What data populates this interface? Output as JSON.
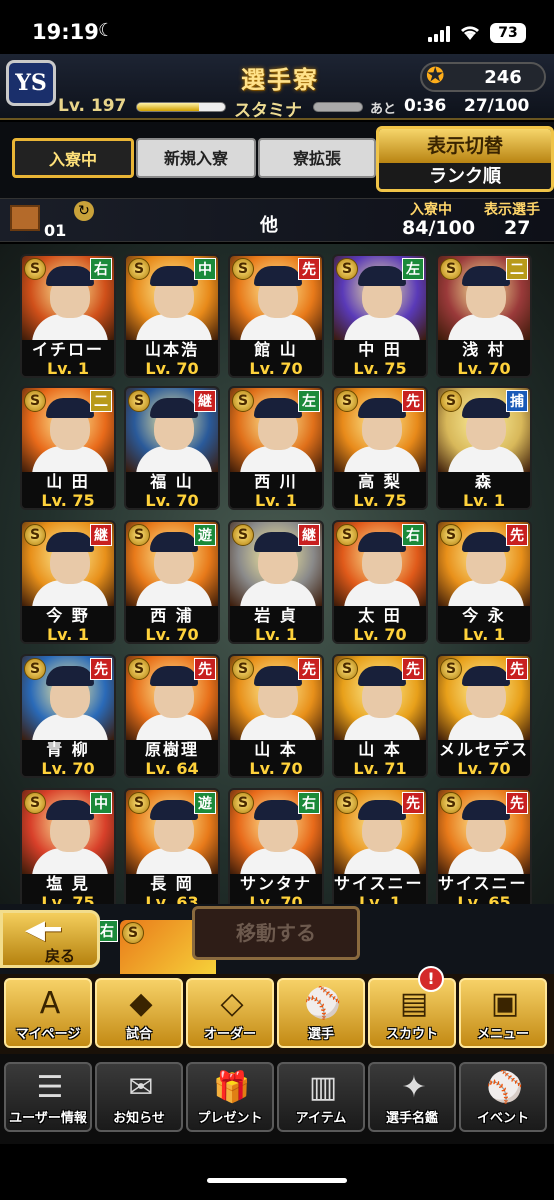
{
  "status_bar": {
    "time": "19:19",
    "battery": "73"
  },
  "header": {
    "title": "選手寮",
    "coins": "246",
    "level": "Lv. 197",
    "stamina_label": "スタミナ",
    "ato_label": "あと",
    "timer": "0:36",
    "stamina": "27/100"
  },
  "tabs": {
    "active": "入寮中",
    "new": "新規入寮",
    "expand": "寮拡張",
    "switch_title": "表示切替",
    "sort": "ランク順"
  },
  "dorm": {
    "number": "01",
    "name": "他",
    "in_dorm_label": "入寮中",
    "in_dorm_value": "84/100",
    "shown_label": "表示選手",
    "shown_value": "27"
  },
  "players": [
    {
      "name": "イチロー",
      "level": "Lv.  1",
      "pos": "右",
      "pos_color": "#1b8a3a",
      "art": "#d0501a"
    },
    {
      "name": "山本浩",
      "level": "Lv. 70",
      "pos": "中",
      "pos_color": "#1b8a3a",
      "art": "#e88a1a"
    },
    {
      "name": "館 山",
      "level": "Lv. 70",
      "pos": "先",
      "pos_color": "#c82020",
      "art": "#e87a1a"
    },
    {
      "name": "中 田",
      "level": "Lv. 75",
      "pos": "左",
      "pos_color": "#1b8a3a",
      "art": "#5a3ab8"
    },
    {
      "name": "浅 村",
      "level": "Lv. 70",
      "pos": "二",
      "pos_color": "#b89a1a",
      "art": "#9a3a3a"
    },
    {
      "name": "山 田",
      "level": "Lv. 75",
      "pos": "二",
      "pos_color": "#b89a1a",
      "art": "#e86a1a"
    },
    {
      "name": "福 山",
      "level": "Lv. 70",
      "pos": "継",
      "pos_color": "#c82020",
      "art": "#2a5a9a"
    },
    {
      "name": "西 川",
      "level": "Lv.  1",
      "pos": "左",
      "pos_color": "#1b8a3a",
      "art": "#e0701a"
    },
    {
      "name": "高 梨",
      "level": "Lv. 75",
      "pos": "先",
      "pos_color": "#c82020",
      "art": "#e88a1a"
    },
    {
      "name": "森",
      "level": "Lv.  1",
      "pos": "捕",
      "pos_color": "#1a5ab8",
      "art": "#d8b85a"
    },
    {
      "name": "今 野",
      "level": "Lv.  1",
      "pos": "継",
      "pos_color": "#c82020",
      "art": "#e8901a"
    },
    {
      "name": "西 浦",
      "level": "Lv. 70",
      "pos": "遊",
      "pos_color": "#1b8a3a",
      "art": "#e87a1a"
    },
    {
      "name": "岩 貞",
      "level": "Lv.  1",
      "pos": "継",
      "pos_color": "#c82020",
      "art": "#8a8a8a"
    },
    {
      "name": "太 田",
      "level": "Lv. 70",
      "pos": "右",
      "pos_color": "#1b8a3a",
      "art": "#e05a1a"
    },
    {
      "name": "今 永",
      "level": "Lv.  1",
      "pos": "先",
      "pos_color": "#c82020",
      "art": "#e8901a"
    },
    {
      "name": "青 柳",
      "level": "Lv. 70",
      "pos": "先",
      "pos_color": "#c82020",
      "art": "#2a6ab8"
    },
    {
      "name": "原樹理",
      "level": "Lv. 64",
      "pos": "先",
      "pos_color": "#c82020",
      "art": "#e8701a"
    },
    {
      "name": "山 本",
      "level": "Lv. 70",
      "pos": "先",
      "pos_color": "#c82020",
      "art": "#e8901a"
    },
    {
      "name": "山 本",
      "level": "Lv. 71",
      "pos": "先",
      "pos_color": "#c82020",
      "art": "#e8a01a"
    },
    {
      "name": "メルセデス",
      "level": "Lv. 70",
      "pos": "先",
      "pos_color": "#c82020",
      "art": "#e8a01a"
    },
    {
      "name": "塩 見",
      "level": "Lv. 75",
      "pos": "中",
      "pos_color": "#1b8a3a",
      "art": "#d8402a"
    },
    {
      "name": "長 岡",
      "level": "Lv. 63",
      "pos": "遊",
      "pos_color": "#1b8a3a",
      "art": "#e87a1a"
    },
    {
      "name": "サンタナ",
      "level": "Lv. 70",
      "pos": "右",
      "pos_color": "#1b8a3a",
      "art": "#e86a1a"
    },
    {
      "name": "サイスニード",
      "level": "Lv.  1",
      "pos": "先",
      "pos_color": "#c82020",
      "art": "#e8901a"
    },
    {
      "name": "サイスニード",
      "level": "Lv. 65",
      "pos": "先",
      "pos_color": "#c82020",
      "art": "#e87a1a"
    }
  ],
  "partial_card": {
    "pos": "右"
  },
  "actions": {
    "back": "戻る",
    "move": "移動する"
  },
  "nav_main": [
    {
      "label": "マイページ",
      "icon": "A"
    },
    {
      "label": "試合",
      "icon": "◆"
    },
    {
      "label": "オーダー",
      "icon": "◇"
    },
    {
      "label": "選手",
      "icon": "⚾"
    },
    {
      "label": "スカウト",
      "icon": "▤"
    },
    {
      "label": "メニュー",
      "icon": "▣"
    }
  ],
  "scout_notification": "!",
  "nav_sub": [
    {
      "label": "ユーザー情報",
      "icon": "☰"
    },
    {
      "label": "お知らせ",
      "icon": "✉"
    },
    {
      "label": "プレゼント",
      "icon": "🎁"
    },
    {
      "label": "アイテム",
      "icon": "▥"
    },
    {
      "label": "選手名鑑",
      "icon": "✦"
    },
    {
      "label": "イベント",
      "icon": "⚾"
    }
  ]
}
